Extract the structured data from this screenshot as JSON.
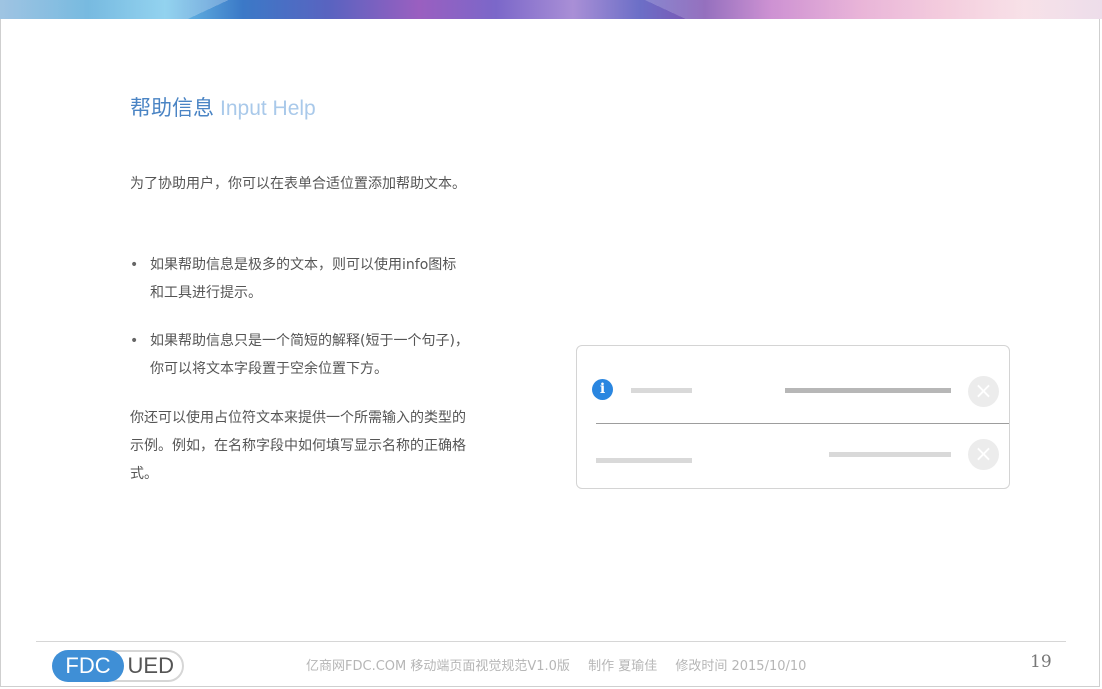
{
  "title": {
    "zh": "帮助信息",
    "en": "Input Help"
  },
  "intro": "为了协助用户，你可以在表单合适位置添加帮助文本。",
  "bullets": [
    "如果帮助信息是极多的文本，则可以使用info图标和工具进行提示。",
    "如果帮助信息只是一个简短的解释(短于一个句子)，你可以将文本字段置于空余位置下方。"
  ],
  "closing": "你还可以使用占位符文本来提供一个所需输入的类型的示例。例如，在名称字段中如何填写显示名称的正确格式。",
  "mockup": {
    "info_icon_glyph": "i",
    "close_icon_glyph": "×",
    "info_color": "#2a86e0"
  },
  "footer": {
    "logo_left": "FDC",
    "logo_right": "UED",
    "site": "亿商网FDC.COM 移动端页面视觉规范V1.0版",
    "author": "制作 夏瑜佳",
    "modified": "修改时间   2015/10/10",
    "page": "19"
  }
}
